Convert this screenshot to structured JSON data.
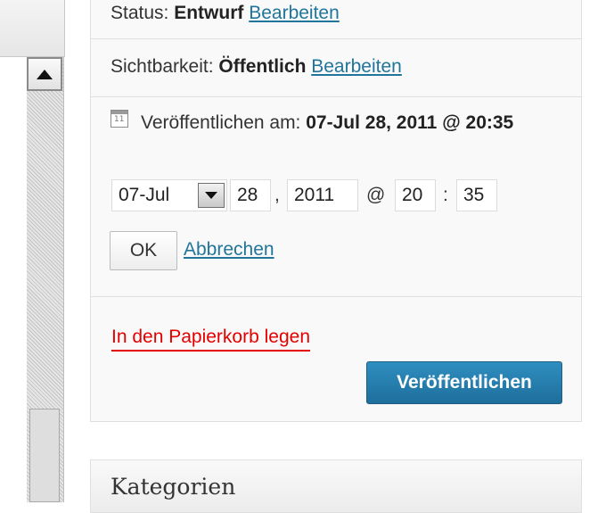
{
  "status": {
    "label": "Status:",
    "value": "Entwurf",
    "edit_link": "Bearbeiten"
  },
  "visibility": {
    "label": "Sichtbarkeit:",
    "value": "Öffentlich",
    "edit_link": "Bearbeiten"
  },
  "publish_date": {
    "icon": "calendar-icon",
    "label": "Veröffentlichen am:",
    "value": "07-Jul 28, 2011 @ 20:35",
    "month": "07-Jul",
    "day": "28",
    "day_sep": ",",
    "year": "2011",
    "at_sep": "@",
    "hour": "20",
    "time_sep": ":",
    "minute": "35",
    "ok_label": "OK",
    "cancel_link": "Abbrechen"
  },
  "actions": {
    "trash_link": "In den Papierkorb legen",
    "publish_button": "Veröffentlichen"
  },
  "categories": {
    "title": "Kategorien"
  },
  "colors": {
    "link": "#21759b",
    "trash": "#e50000",
    "publish_button": "#2181b3"
  }
}
